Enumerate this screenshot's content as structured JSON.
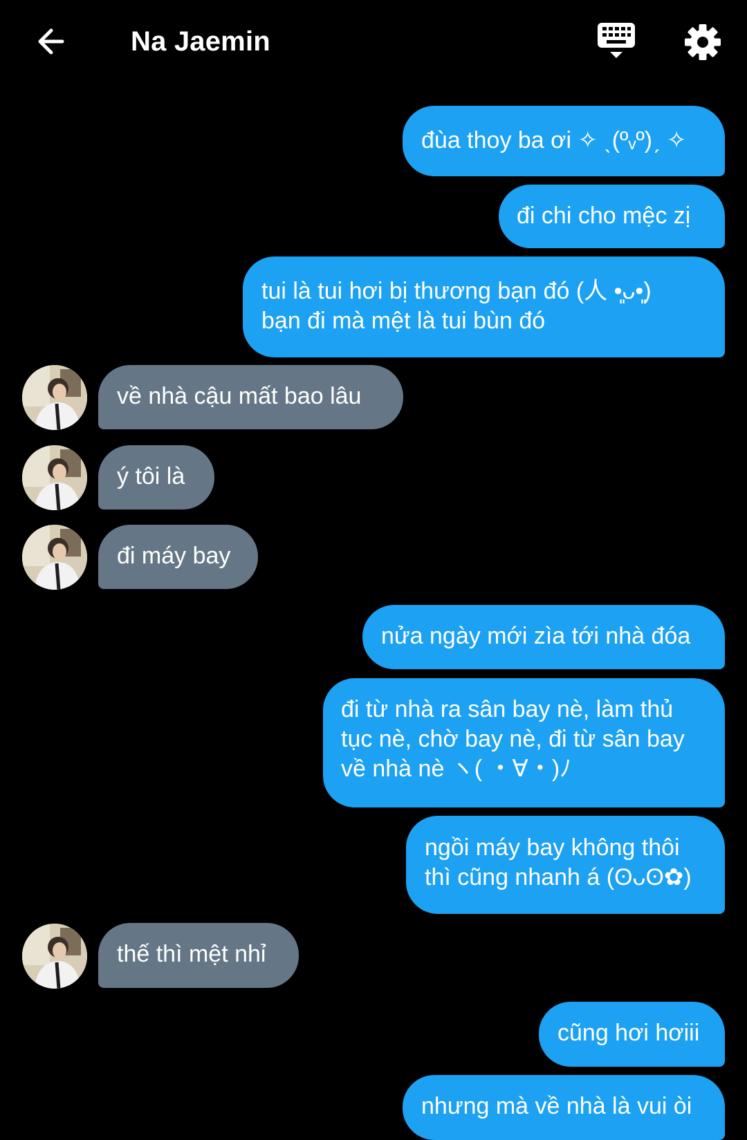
{
  "header": {
    "title": "Na Jaemin",
    "back_icon": "arrow-left-icon",
    "keyboard_icon": "keyboard-icon",
    "settings_icon": "gear-icon"
  },
  "colors": {
    "background": "#000000",
    "outgoing_bubble": "#1da1f2",
    "incoming_bubble": "#657786",
    "text": "#ffffff"
  },
  "messages": [
    {
      "side": "out",
      "text": "đùa thoy ba ơi ✧ ˎ(ºᵥº)ˏ ✧"
    },
    {
      "side": "out",
      "text": "đi chi cho mệc zị"
    },
    {
      "side": "out",
      "text": "tui là tui hơi bị thương bạn đó (人 •͈ᴗ•͈)\nbạn đi mà mệt là tui bùn đó"
    },
    {
      "side": "in",
      "text": "về nhà cậu mất bao lâu"
    },
    {
      "side": "in",
      "text": "ý tôi là"
    },
    {
      "side": "in",
      "text": "đi máy bay"
    },
    {
      "side": "out",
      "text": "nửa ngày mới zìa tới nhà đóa"
    },
    {
      "side": "out",
      "text": "đi từ nhà ra sân bay nè, làm thủ\ntục nè, chờ bay nè, đi từ sân bay\nvề nhà nè ヽ( ・∀・)ﾉ"
    },
    {
      "side": "out",
      "text": "ngồi máy bay không thôi\nthì cũng nhanh á (ʘᴗʘ✿)"
    },
    {
      "side": "in",
      "text": "thế thì mệt nhỉ"
    },
    {
      "side": "out",
      "text": "cũng hơi hơiii"
    },
    {
      "side": "out",
      "text": "nhưng mà về nhà là vui òi"
    }
  ]
}
